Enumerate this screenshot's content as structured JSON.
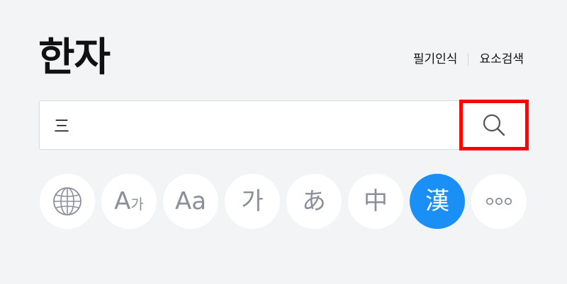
{
  "header": {
    "title": "한자",
    "links": [
      {
        "label": "필기인식"
      },
      {
        "label": "요소검색"
      }
    ]
  },
  "search": {
    "value": "三",
    "button_icon": "search-icon"
  },
  "chips": [
    {
      "icon": "globe-icon",
      "label": ""
    },
    {
      "icon": "a-ga-icon",
      "label": "A",
      "sub": "가"
    },
    {
      "icon": "aa-icon",
      "label": "Aa"
    },
    {
      "icon": "korean-icon",
      "label": "가"
    },
    {
      "icon": "japanese-icon",
      "label": "あ"
    },
    {
      "icon": "chinese-icon",
      "label": "中"
    },
    {
      "icon": "hanja-icon",
      "label": "漢",
      "active": true
    },
    {
      "icon": "more-icon",
      "label": ""
    }
  ],
  "colors": {
    "background": "#f3f4f6",
    "accent": "#1a8ff5",
    "highlight_border": "#ff0000",
    "chip_text": "#8a8f99"
  }
}
